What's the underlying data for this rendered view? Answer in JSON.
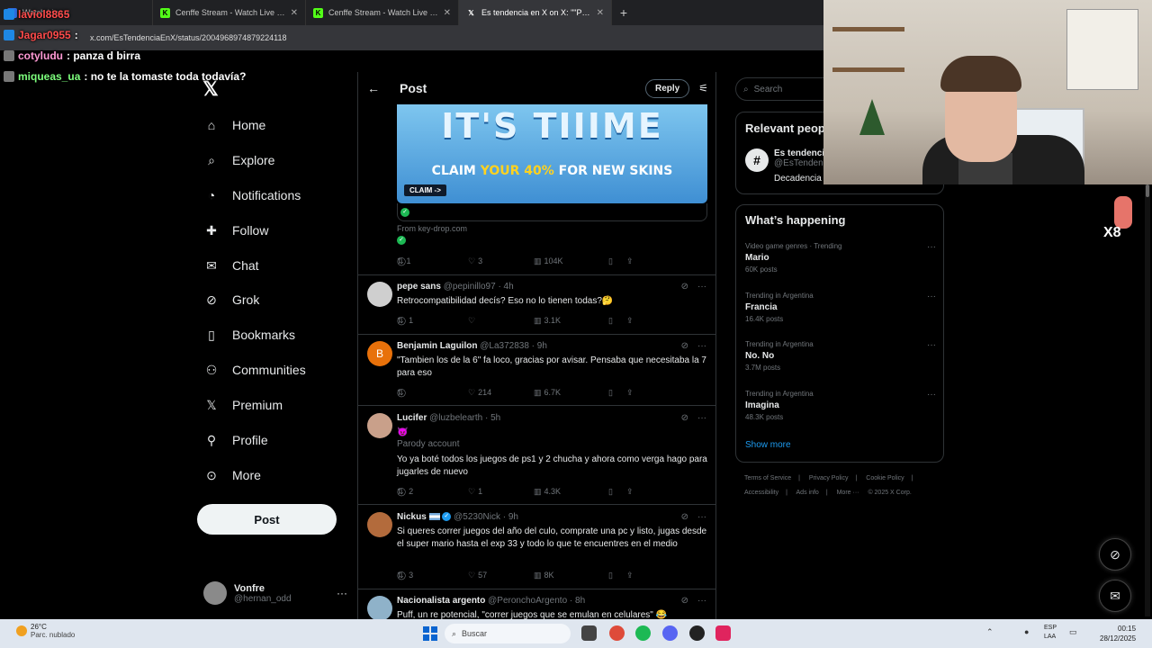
{
  "browser": {
    "tabs": [
      {
        "title": "Watch Live o",
        "favicon_color": "#2d6cdf"
      },
      {
        "title": "Cenffe Stream - Watch Live on K",
        "favicon_color": "#53fc18"
      },
      {
        "title": "Cenffe Stream - Watch Live on K",
        "favicon_color": "#53fc18"
      },
      {
        "title": "Es tendencia en X on X: \"\"PS6\"",
        "favicon_color": "#ffffff"
      }
    ],
    "new_tab": "+",
    "url": "x.com/EsTendenciaEnX/status/2004968974879224118"
  },
  "chat": [
    {
      "user": "laviol8865",
      "msg": "",
      "color": "#ff4b4b"
    },
    {
      "user": "Jagar0955",
      "msg": ":",
      "color": "#ff4b4b"
    },
    {
      "user": "cotyludu",
      "msg": ": panza d birra",
      "color": "#ff9ad5"
    },
    {
      "user": "miqueas_ua",
      "msg": ": no te la tomaste toda todavía?",
      "color": "#7dff7d"
    }
  ],
  "nav": {
    "logo": "𝕏",
    "items": [
      {
        "label": "Home",
        "icon": "⌂"
      },
      {
        "label": "Explore",
        "icon": "⌕"
      },
      {
        "label": "Notifications",
        "icon": "🔔"
      },
      {
        "label": "Follow",
        "icon": "+"
      },
      {
        "label": "Chat",
        "icon": "✉"
      },
      {
        "label": "Grok",
        "icon": "⊘"
      },
      {
        "label": "Bookmarks",
        "icon": "⌑"
      },
      {
        "label": "Communities",
        "icon": "⚇"
      },
      {
        "label": "Premium",
        "icon": "𝕏"
      },
      {
        "label": "Profile",
        "icon": "⚲"
      },
      {
        "label": "More",
        "icon": "⋯"
      }
    ],
    "post_label": "Post",
    "profile": {
      "name": "Vonfre",
      "handle": "@hernan_odd"
    }
  },
  "main": {
    "header_title": "Post",
    "reply_label": "Reply",
    "banner": {
      "headline": "IT'S TIIIME",
      "sub_a": "CLAIM ",
      "sub_hl": "YOUR 40%",
      "sub_b": " FOR NEW SKINS",
      "claim": "CLAIM ->"
    },
    "from": "From key-drop.com",
    "main_stats": {
      "replies": "",
      "reposts": "1",
      "likes": "3",
      "views": "104K"
    },
    "replies": [
      {
        "name": "pepe sans",
        "handle": "@pepinillo97 · 4h",
        "text": "Retrocompatibilidad decís? Eso no lo tienen todas?🤔",
        "stats": {
          "replies": "1",
          "reposts": "",
          "likes": "",
          "views": "3.1K"
        },
        "avatar_color": "#cfcfcf"
      },
      {
        "name": "Benjamin Laguilon",
        "handle": "@La372838 · 9h",
        "text": "\"Tambien los de la 6\" fa loco, gracias por avisar. Pensaba que necesitaba la 7 para eso",
        "stats": {
          "replies": "",
          "reposts": "",
          "likes": "214",
          "views": "6.7K"
        },
        "avatar_color": "#e8710a",
        "avatar_letter": "B"
      },
      {
        "name": "Lucifer",
        "handle": "@luzbelearth · 5h",
        "emoji": "😈",
        "parody": "Parody account",
        "text": "Yo ya boté todos los juegos de ps1 y 2 chucha y ahora como verga hago para jugarles de nuevo",
        "stats": {
          "replies": "2",
          "reposts": "",
          "likes": "1",
          "views": "4.3K"
        },
        "avatar_color": "#c9a08a"
      },
      {
        "name": "Nickus",
        "handle": "@5230Nick · 9h",
        "text": "Si queres correr juegos del año del culo, comprate una pc y listo, jugas desde el super mario hasta el exp 33 y todo lo que te encuentres en el medio",
        "stats": {
          "replies": "3",
          "reposts": "",
          "likes": "57",
          "views": "8K"
        },
        "avatar_color": "#b36b3c"
      },
      {
        "name": "Nacionalista argento",
        "handle": "@PeronchoArgento · 8h",
        "text": "Puff, un re potencial, \"correr juegos que se emulan en celulares\" 😂",
        "avatar_color": "#8fb2c9"
      }
    ]
  },
  "right": {
    "search_placeholder": "Search",
    "relevant": {
      "title": "Relevant people",
      "name": "Es tendencia",
      "handle": "@EsTendenc",
      "desc": "Decadencia"
    },
    "happening": {
      "title": "What’s happening",
      "trends": [
        {
          "context": "Video game genres · Trending",
          "topic": "Mario",
          "count": "60K posts"
        },
        {
          "context": "Trending in Argentina",
          "topic": "Francia",
          "count": "16.4K posts"
        },
        {
          "context": "Trending in Argentina",
          "topic": "No. No",
          "count": "3.7M posts"
        },
        {
          "context": "Trending in Argentina",
          "topic": "Imagina",
          "count": "48.3K posts"
        }
      ],
      "show_more": "Show more"
    },
    "footer_row1": [
      "Terms of Service",
      "|",
      "Privacy Policy",
      "|",
      "Cookie Policy",
      "|"
    ],
    "footer_row2": [
      "Accessibility",
      "|",
      "Ads info",
      "|",
      "More ···",
      "© 2025 X Corp."
    ]
  },
  "overlay": {
    "x8": "X8"
  },
  "taskbar": {
    "temp": "26°C",
    "weather": "Parc. nublado",
    "search": "Buscar",
    "lang1": "ESP",
    "lang2": "LAA",
    "time": "00:15",
    "date": "28/12/2025"
  }
}
